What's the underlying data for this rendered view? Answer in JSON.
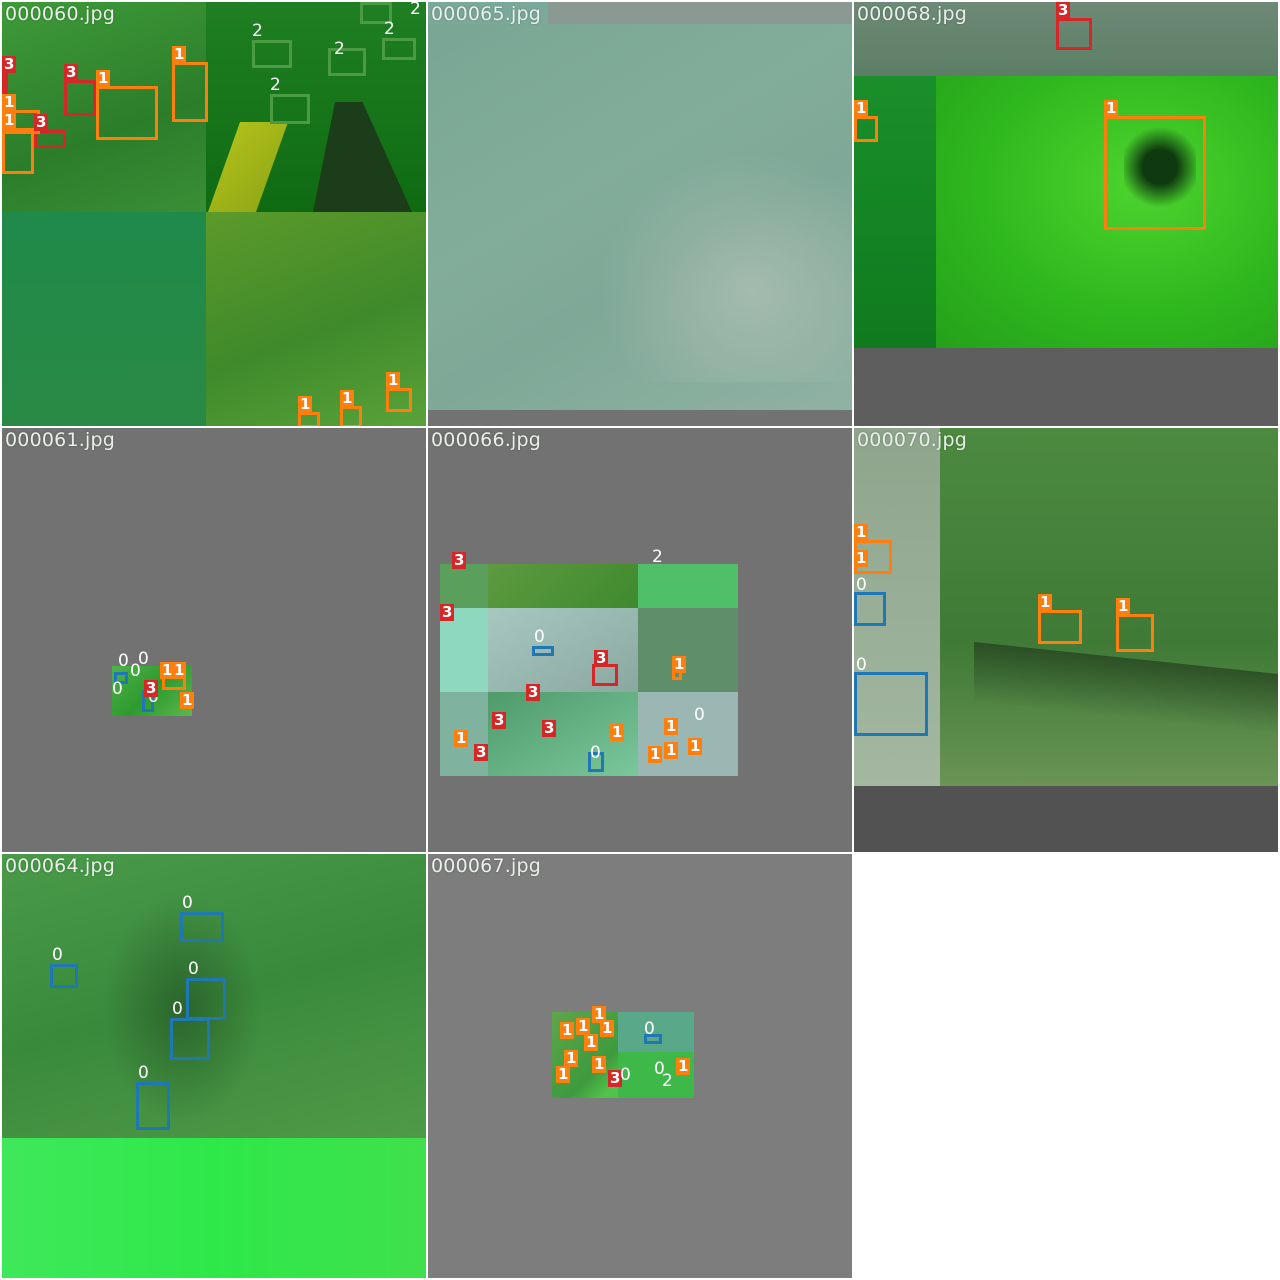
{
  "tiles": [
    {
      "label": "000060.jpg"
    },
    {
      "label": "000065.jpg"
    },
    {
      "label": "000068.jpg"
    },
    {
      "label": "000061.jpg"
    },
    {
      "label": "000066.jpg"
    },
    {
      "label": "000070.jpg"
    },
    {
      "label": "000064.jpg"
    },
    {
      "label": "000067.jpg"
    }
  ],
  "class_labels": {
    "c0": "0",
    "c1": "1",
    "c2": "2",
    "c3": "3"
  },
  "colors": {
    "class0": "#1f77b4",
    "class1": "#ff7f0e",
    "class2": "#2ca02c",
    "class3": "#d62728",
    "padding": "#727272"
  }
}
